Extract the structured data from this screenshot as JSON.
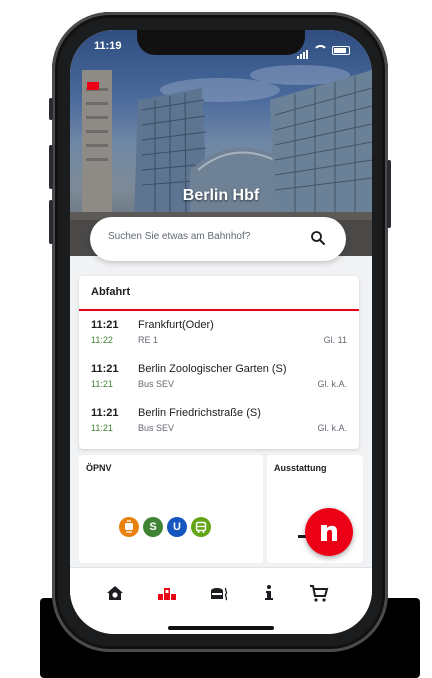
{
  "status_bar": {
    "time": "11:19"
  },
  "header": {
    "station_name": "Berlin Hbf"
  },
  "search": {
    "placeholder": "Suchen Sie etwas am Bahnhof?"
  },
  "departures": {
    "title": "Abfahrt",
    "rows": [
      {
        "time": "11:21",
        "actual_time": "11:22",
        "destination": "Frankfurt(Oder)",
        "line": "RE 1",
        "track": "Gl. 11"
      },
      {
        "time": "11:21",
        "actual_time": "11:21",
        "destination": "Berlin Zoologischer Garten (S)",
        "line": "Bus SEV",
        "track": "Gl. k.A."
      },
      {
        "time": "11:21",
        "actual_time": "11:21",
        "destination": "Berlin Friedrichstraße (S)",
        "line": "Bus SEV",
        "track": "Gl. k.A."
      }
    ]
  },
  "oepnv": {
    "title": "ÖPNV",
    "badges": [
      {
        "icon": "tram-icon",
        "color": "#e8820c"
      },
      {
        "label": "S",
        "color": "#408335"
      },
      {
        "label": "U",
        "color": "#1455c0"
      },
      {
        "icon": "bus-icon",
        "color": "#63a615"
      }
    ]
  },
  "amenities": {
    "title": "Ausstattung"
  },
  "fab": {
    "icon": "db-navigator-icon",
    "color": "#ec0016"
  },
  "tabbar": {
    "tabs": [
      {
        "icon": "station-home-icon",
        "active": false
      },
      {
        "icon": "departures-icon",
        "active": true
      },
      {
        "icon": "shopping-services-icon",
        "active": false
      },
      {
        "icon": "info-icon",
        "active": false
      },
      {
        "icon": "cart-icon",
        "active": false
      }
    ]
  },
  "colors": {
    "db_red": "#ec0016",
    "on_time_green": "#408335",
    "text": "#1b1d21",
    "secondary_text": "#646973"
  }
}
